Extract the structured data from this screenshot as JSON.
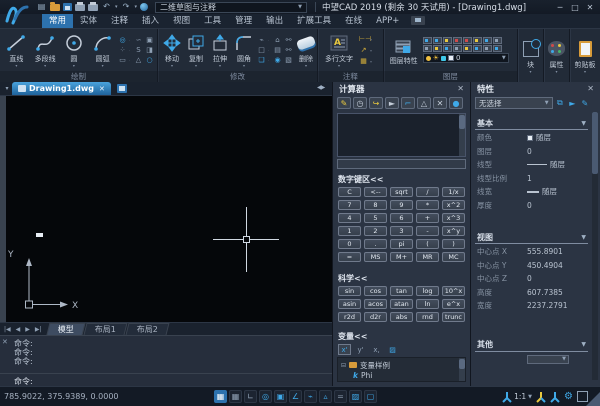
{
  "titlebar": {
    "workspace": "二维草图与注释",
    "title": "中望CAD 2019 (剩余 30 天试用) - [Drawing1.dwg]",
    "minimize": "─",
    "maximize": "□",
    "close": "✕"
  },
  "menu": {
    "tabs": [
      "常用",
      "实体",
      "注释",
      "插入",
      "视图",
      "工具",
      "管理",
      "输出",
      "扩展工具",
      "在线",
      "APP+"
    ],
    "active_tab": "常用"
  },
  "ribbon": {
    "draw": {
      "label": "绘制",
      "tools": [
        "直线",
        "多段线",
        "圆",
        "圆弧"
      ]
    },
    "modify": {
      "label": "修改",
      "tools": [
        "移动",
        "复制",
        "拉伸",
        "圆角",
        "删除"
      ]
    },
    "annotate": {
      "label": "注释",
      "text_tool": "多行文字"
    },
    "layers": {
      "label": "图层",
      "tool": "图层特性",
      "current_layer": "0"
    },
    "block_label": "块",
    "properties_label": "属性",
    "clipboard_label": "剪贴板"
  },
  "document_tab": {
    "name": "Drawing1.dwg"
  },
  "calculator": {
    "title": "计算器",
    "numpad_header": "数字键区<<",
    "numpad_rows": [
      [
        "C",
        "<--",
        "sqrt",
        "/",
        "1/x"
      ],
      [
        "7",
        "8",
        "9",
        "*",
        "x^2"
      ],
      [
        "4",
        "5",
        "6",
        "+",
        "x^3"
      ],
      [
        "1",
        "2",
        "3",
        "-",
        "x^y"
      ],
      [
        "0",
        ".",
        "pi",
        "(",
        ")"
      ],
      [
        "=",
        "MS",
        "M+",
        "MR",
        "MC"
      ]
    ],
    "scientific_header": "科学<<",
    "scientific_rows": [
      [
        "sin",
        "cos",
        "tan",
        "log",
        "10^x"
      ],
      [
        "asin",
        "acos",
        "atan",
        "ln",
        "e^x"
      ],
      [
        "r2d",
        "d2r",
        "abs",
        "rnd",
        "trunc"
      ]
    ],
    "variables_header": "变量<<",
    "tree": {
      "folder": "变量样例",
      "item_key": "k",
      "item": "Phi"
    }
  },
  "properties_panel": {
    "title": "特性",
    "selection": "无选择",
    "basic": {
      "name": "基本",
      "rows": [
        {
          "label": "颜色",
          "value": "随层"
        },
        {
          "label": "图层",
          "value": "0"
        },
        {
          "label": "线型",
          "value": "随层"
        },
        {
          "label": "线型比例",
          "value": "1"
        },
        {
          "label": "线宽",
          "value": "随层"
        },
        {
          "label": "厚度",
          "value": "0"
        }
      ]
    },
    "view": {
      "name": "视图",
      "rows": [
        {
          "label": "中心点 X",
          "value": "555.8901"
        },
        {
          "label": "中心点 Y",
          "value": "450.4904"
        },
        {
          "label": "中心点 Z",
          "value": "0"
        },
        {
          "label": "高度",
          "value": "607.7385"
        },
        {
          "label": "宽度",
          "value": "2237.2791"
        }
      ]
    },
    "other": {
      "name": "其他"
    }
  },
  "layout_tabs": {
    "tabs": [
      "模型",
      "布局1",
      "布局2"
    ],
    "active": "模型"
  },
  "command_line": {
    "history": [
      "命令:",
      "命令:",
      "命令:"
    ],
    "prompt": "命令:"
  },
  "statusbar": {
    "coordinates": "785.9022, 375.9389, 0.0000",
    "annotation_scale": "1:1"
  },
  "ucs": {
    "x_label": "X",
    "y_label": "Y"
  }
}
